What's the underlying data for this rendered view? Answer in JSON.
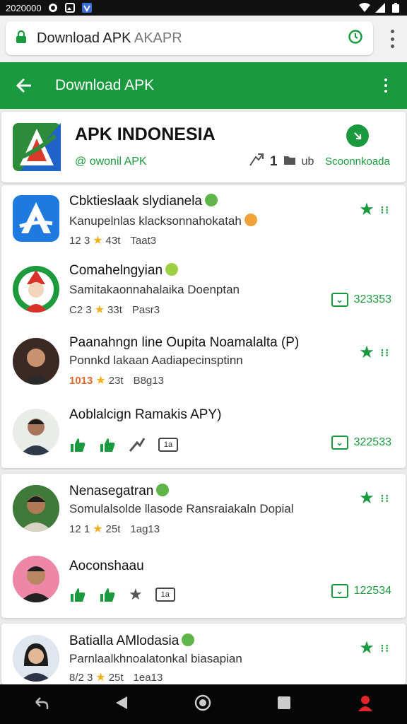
{
  "status_bar": {
    "time": "2020000"
  },
  "browser": {
    "url_text": "Download APK",
    "url_hint": "AKAPR"
  },
  "app_bar": {
    "title": "Download APK"
  },
  "hero": {
    "title": "APK INDONESIA",
    "subtitle": "@ owonil APK",
    "stat_value": "1",
    "stat_suffix": "ub",
    "download_label": "Scoonnkoada"
  },
  "items": [
    {
      "name": "Cbktieslaak slydianela",
      "desc": "Kanupelnlas klacksonnahokatah",
      "meta_a": "12 3",
      "meta_b": "43t",
      "meta_c": "Taat3",
      "rating_dots": "⁝⁝"
    },
    {
      "name": "Comahelngyian",
      "desc": "Samitakaonnahalaika Doenptan",
      "meta_a": "C2 3",
      "meta_b": "33t",
      "meta_c": "Pasr3",
      "count": "323353"
    },
    {
      "name": "Paanahngn line Oupita Noamalalta (P)",
      "desc": "Ponnkd lakaan Aadiapecinsptinn",
      "meta_a": "1013",
      "meta_b": "23t",
      "meta_c": "B8g13",
      "rating_dots": "⁝⁝"
    },
    {
      "name": "Aoblalcign Ramakis APY)",
      "count": "322533"
    },
    {
      "name": "Nenasegatran",
      "desc": "Somulalsolde llasode Ransraiakaln Dopial",
      "meta_a": "12 1",
      "meta_b": "25t",
      "meta_c": "1ag13",
      "rating_dots": "⁝⁝"
    },
    {
      "name": "Aoconshaau",
      "count": "122534"
    },
    {
      "name": "Batialla AMlodasia",
      "desc": "Parnlaalkhnoalatonkal biasapian",
      "meta_a": "8/2 3",
      "meta_b": "25t",
      "meta_c": "1ea13",
      "rating_dots": "⁝⁝"
    }
  ],
  "colors": {
    "brand_green": "#1a9a3e",
    "star_gold": "#f2b01e",
    "status_bg": "#111111"
  }
}
